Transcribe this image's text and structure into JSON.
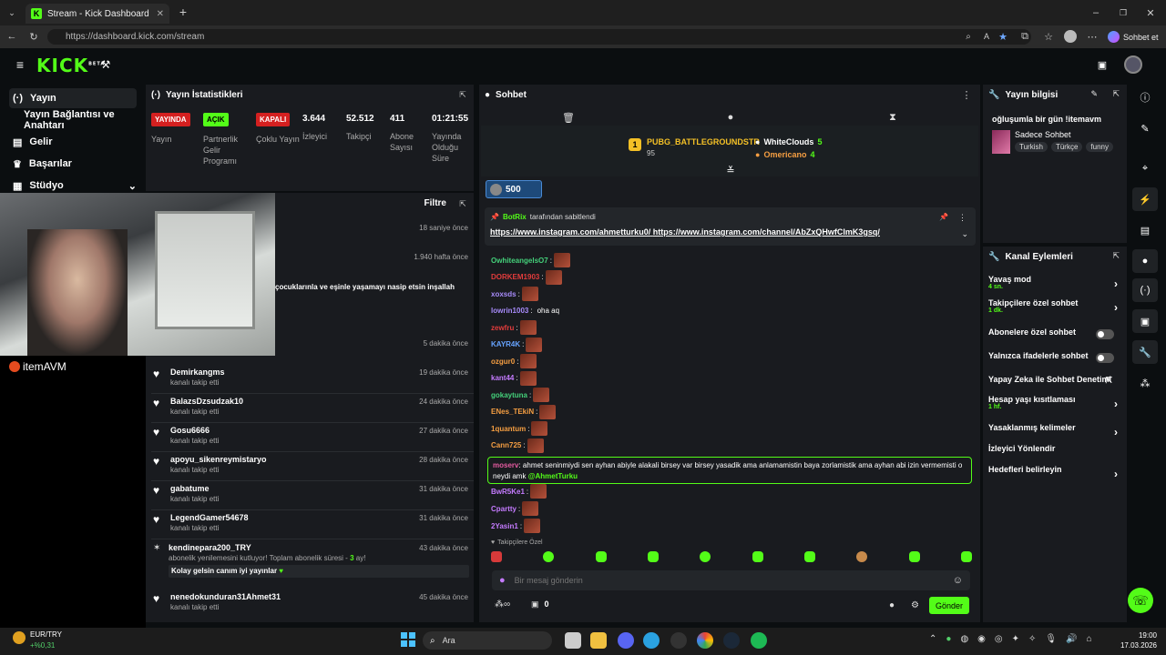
{
  "browser": {
    "tab_title": "Stream - Kick Dashboard",
    "url": "https://dashboard.kick.com/stream",
    "profile_label": "Sohbet et"
  },
  "nav": {
    "logo": "KICK",
    "logo_badge": "BETA"
  },
  "sidebar": {
    "items": [
      {
        "label": "Yayın",
        "icon": "broadcast-icon"
      },
      {
        "label": "Yayın Bağlantısı ve Anahtarı",
        "icon": ""
      },
      {
        "label": "Gelir",
        "icon": "revenue-icon"
      },
      {
        "label": "Başarılar",
        "icon": "trophy-icon"
      },
      {
        "label": "Stüdyo",
        "icon": "studio-icon"
      }
    ]
  },
  "stats": {
    "title": "Yayın İstatistikleri",
    "badges": [
      {
        "badge": "YAYINDA",
        "label": "Yayın",
        "color": "#d42020"
      },
      {
        "badge": "AÇIK",
        "label": "Partnerlik Gelir Programı",
        "color": "#53fc18"
      },
      {
        "badge": "KAPALI",
        "label": "Çoklu Yayın",
        "color": "#d42020"
      }
    ],
    "values": [
      {
        "value": "3.644",
        "label": "İzleyici"
      },
      {
        "value": "52.512",
        "label": "Takipçi"
      },
      {
        "value": "411",
        "label": "Abone Sayısı"
      },
      {
        "value": "01:21:55",
        "label": "Yayında Olduğu Süre"
      }
    ]
  },
  "activity": {
    "filter_label": "Filtre",
    "partial_times": [
      "18 saniye önce",
      "1.940 hafta önce",
      "5 dakika önce"
    ],
    "partial_message": "çocuklarınla ve eşinle yaşamayı nasip etsin inşallah",
    "overlay_brand": "itemAVM",
    "rows": [
      {
        "name": "Demirkangms",
        "sub": "kanalı takip etti",
        "time": "19 dakika önce"
      },
      {
        "name": "BalazsDzsudzak10",
        "sub": "kanalı takip etti",
        "time": "24 dakika önce"
      },
      {
        "name": "Gosu6666",
        "sub": "kanalı takip etti",
        "time": "27 dakika önce"
      },
      {
        "name": "apoyu_sikenreymistaryo",
        "sub": "kanalı takip etti",
        "time": "28 dakika önce"
      },
      {
        "name": "gabatume",
        "sub": "kanalı takip etti",
        "time": "31 dakika önce"
      },
      {
        "name": "LegendGamer54678",
        "sub": "kanalı takip etti",
        "time": "31 dakika önce"
      }
    ],
    "sub_row": {
      "name": "kendinepara200_TRY",
      "text_before": "abonelik yenilemesini kutluyor! Toplam abonelik süresi -",
      "months": "3",
      "text_after": "ay!",
      "message": "Kolay gelsin canım iyi yayınlar",
      "time": "43 dakika önce"
    },
    "last_row": {
      "name": "nenedokunduran31Ahmet31",
      "sub": "kanalı takip etti",
      "time": "45 dakika önce"
    }
  },
  "chat": {
    "title": "Sohbet",
    "leaders": [
      {
        "rank": "1",
        "name": "PUBG_BATTLEGROUNDSTR",
        "points": "95"
      },
      {
        "name": "WhiteClouds",
        "points": "5"
      },
      {
        "name": "Omericano",
        "points": "4"
      }
    ],
    "gift_count": "500",
    "pinned_by": "BotRix",
    "pinned_by_suffix": "tarafından sabitlendi",
    "pinned_link1": "https://www.instagram.com/ahmetturku0/",
    "pinned_link2": "https://www.instagram.com/channel/AbZxQHwfClmK3gsq/",
    "messages": [
      {
        "user": "OwhiteangelsO7",
        "color": "#44d07a",
        "text": ""
      },
      {
        "user": "DORKEM1903",
        "color": "#e23c3c",
        "text": ""
      },
      {
        "user": "xoxsds",
        "color": "#a78bfa",
        "text": ""
      },
      {
        "user": "lowrin1003",
        "color": "#a78bfa",
        "text": "oha aq"
      },
      {
        "user": "zewfru",
        "color": "#e23c3c",
        "text": ""
      },
      {
        "user": "KAYR4K",
        "color": "#66a3ff",
        "text": ""
      },
      {
        "user": "ozgur0",
        "color": "#f59e42",
        "text": ""
      },
      {
        "user": "kant44",
        "color": "#c57bff",
        "text": ""
      },
      {
        "user": "gokaytuna",
        "color": "#44d07a",
        "text": ""
      },
      {
        "user": "ENes_TEkiN",
        "color": "#f59e42",
        "text": ""
      },
      {
        "user": "1quantum",
        "color": "#f59e42",
        "text": ""
      },
      {
        "user": "Cann725",
        "color": "#f59e42",
        "text": ""
      }
    ],
    "highlight": {
      "user": "moserv",
      "text": "ahmet seninmiydi sen ayhan abiyle alakali birsey var birsey yasadik ama anlamamistin baya zorlamistik ama ayhan abi izin vermemisti o neydi amk",
      "mention": "@AhmetTurku"
    },
    "messages2": [
      {
        "user": "BwR5Ke1",
        "color": "#c57bff"
      },
      {
        "user": "Cpartty",
        "color": "#c57bff"
      },
      {
        "user": "2Yasin1",
        "color": "#c57bff"
      }
    ],
    "followers_only": "Takipçilere Özel",
    "placeholder": "Bir mesaj gönderin",
    "points": "0",
    "send_label": "Gönder"
  },
  "stream_info": {
    "title": "Yayın bilgisi",
    "stream_title": "oğluşumla bir gün !itemavm",
    "category": "Sadece Sohbet",
    "tags": [
      "Turkish",
      "Türkçe",
      "funny"
    ]
  },
  "channel_actions": {
    "title": "Kanal Eylemleri",
    "rows": [
      {
        "label": "Yavaş mod",
        "sub": "4 sn.",
        "control": "chevron"
      },
      {
        "label": "Takipçilere özel sohbet",
        "sub": "1 dk.",
        "control": "chevron"
      },
      {
        "label": "Abonelere özel sohbet",
        "sub": "",
        "control": "toggle"
      },
      {
        "label": "Yalnızca ifadelerle sohbet",
        "sub": "",
        "control": "toggle"
      },
      {
        "label": "Yapay Zeka ile Sohbet Denetimi",
        "sub": "",
        "control": "external"
      },
      {
        "label": "Hesap yaşı kısıtlaması",
        "sub": "1 hf.",
        "control": "chevron"
      },
      {
        "label": "Yasaklanmış kelimeler",
        "sub": "",
        "control": "chevron"
      },
      {
        "label": "İzleyici Yönlendir",
        "sub": "",
        "control": "none"
      },
      {
        "label": "Hedefleri belirleyin",
        "sub": "",
        "control": "chevron"
      }
    ]
  },
  "taskbar": {
    "ticker_name": "EUR/TRY",
    "ticker_change": "+%0,31",
    "search_label": "Ara",
    "time": "19:00",
    "date": "17.03.2026"
  }
}
